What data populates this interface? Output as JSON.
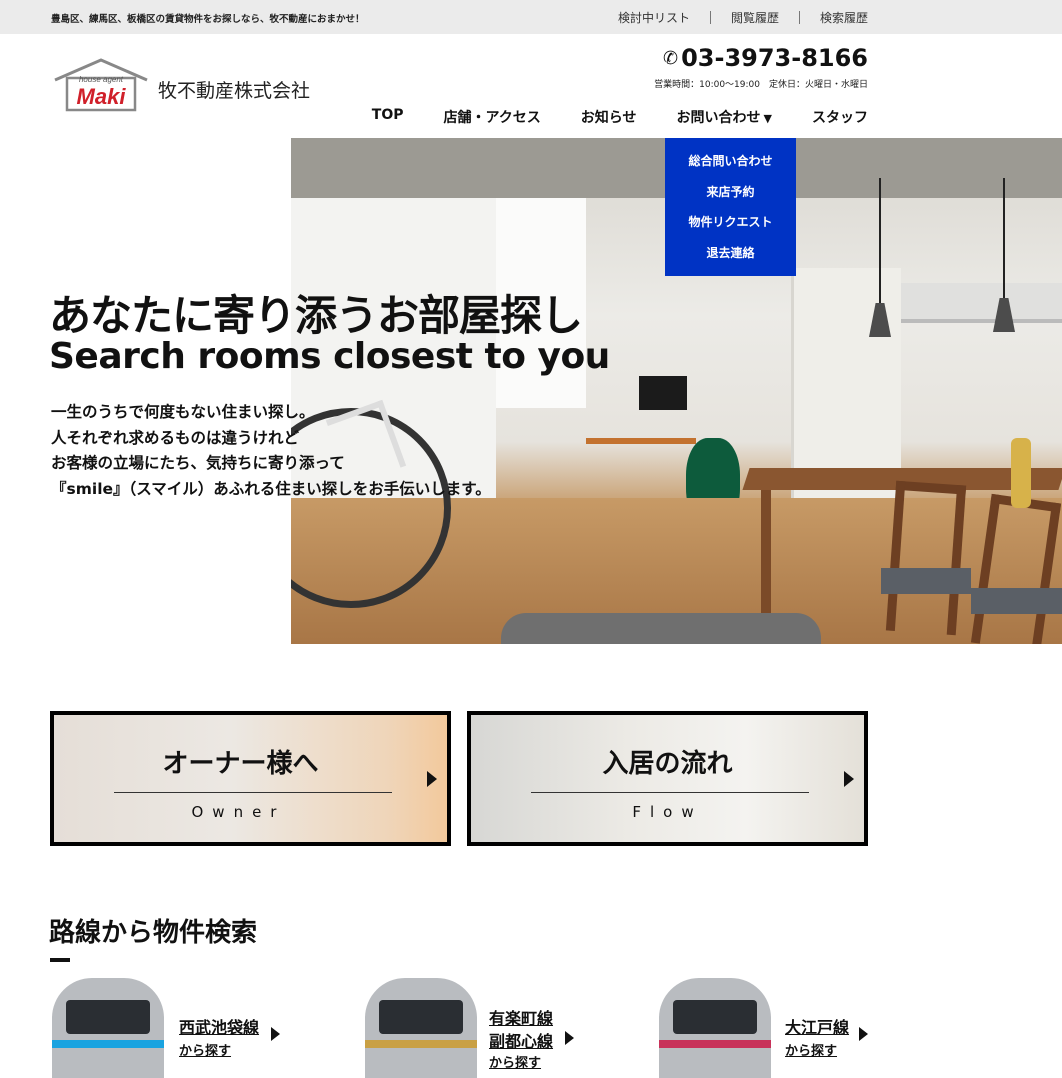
{
  "topbar": {
    "tagline": "豊島区、練馬区、板橋区の賃貸物件をお探しなら、牧不動産におまかせ！",
    "links": [
      "検討中リスト",
      "閲覧履歴",
      "検索履歴"
    ]
  },
  "header": {
    "logo_small": "house agent",
    "logo_main": "Maki",
    "company_name": "牧不動産株式会社",
    "phone": "03-3973-8166",
    "hours": "営業時間：10:00～19:00　定休日：火曜日・水曜日"
  },
  "nav": {
    "items": [
      "TOP",
      "店舗・アクセス",
      "お知らせ",
      "お問い合わせ",
      "スタッフ"
    ],
    "dropdown_items": [
      "総合問い合わせ",
      "来店予約",
      "物件リクエスト",
      "退去連絡"
    ]
  },
  "hero": {
    "title": "あなたに寄り添うお部屋探し",
    "subtitle": "Search rooms closest to you",
    "body": [
      "一生のうちで何度もない住まい探し。",
      "人それぞれ求めるものは違うけれど",
      "お客様の立場にたち、気持ちに寄り添って",
      "『smile』（スマイル）あふれる住まい探しをお手伝いします。"
    ]
  },
  "cards": [
    {
      "title": "オーナー様へ",
      "en": "Owner"
    },
    {
      "title": "入居の流れ",
      "en": "Flow"
    }
  ],
  "line_search": {
    "title": "路線から物件検索",
    "from_label": "から探す",
    "lines": [
      {
        "names": [
          "西武池袋線"
        ],
        "color": "#1aa3e0"
      },
      {
        "names": [
          "有楽町線",
          "副都心線"
        ],
        "color": "#c9a045"
      },
      {
        "names": [
          "大江戸線"
        ],
        "color": "#c8325a"
      }
    ]
  }
}
